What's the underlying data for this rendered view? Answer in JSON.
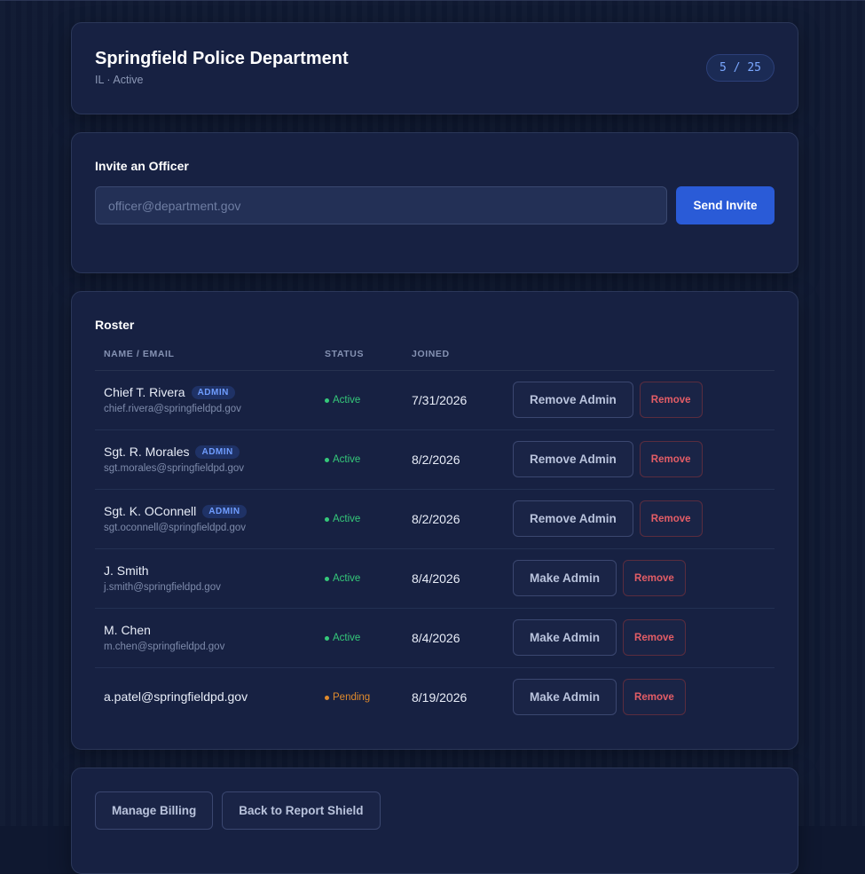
{
  "header": {
    "title": "Springfield Police Department",
    "subtitle": "IL · Active",
    "seats": "5 / 25"
  },
  "invite": {
    "title": "Invite an Officer",
    "placeholder": "officer@department.gov",
    "send_label": "Send Invite"
  },
  "roster": {
    "title": "Roster",
    "columns": {
      "name": "NAME / EMAIL",
      "status": "STATUS",
      "joined": "JOINED"
    },
    "admin_tag": "ADMIN",
    "remove_label": "Remove",
    "rows": [
      {
        "name": "Chief T. Rivera",
        "email": "chief.rivera@springfieldpd.gov",
        "admin": true,
        "status": "Active",
        "joined": "7/31/2026",
        "role_action": "Remove Admin"
      },
      {
        "name": "Sgt. R. Morales",
        "email": "sgt.morales@springfieldpd.gov",
        "admin": true,
        "status": "Active",
        "joined": "8/2/2026",
        "role_action": "Remove Admin"
      },
      {
        "name": "Sgt. K. OConnell",
        "email": "sgt.oconnell@springfieldpd.gov",
        "admin": true,
        "status": "Active",
        "joined": "8/2/2026",
        "role_action": "Remove Admin"
      },
      {
        "name": "J. Smith",
        "email": "j.smith@springfieldpd.gov",
        "admin": false,
        "status": "Active",
        "joined": "8/4/2026",
        "role_action": "Make Admin"
      },
      {
        "name": "M. Chen",
        "email": "m.chen@springfieldpd.gov",
        "admin": false,
        "status": "Active",
        "joined": "8/4/2026",
        "role_action": "Make Admin"
      },
      {
        "name": "a.patel@springfieldpd.gov",
        "email": "",
        "admin": false,
        "status": "Pending",
        "joined": "8/19/2026",
        "role_action": "Make Admin"
      }
    ]
  },
  "footer": {
    "billing_label": "Manage Billing",
    "back_label": "Back to Report Shield"
  },
  "colors": {
    "accent": "#2a5bd7",
    "active": "#35c97a",
    "pending": "#e08a2c",
    "danger": "#e35d66"
  }
}
